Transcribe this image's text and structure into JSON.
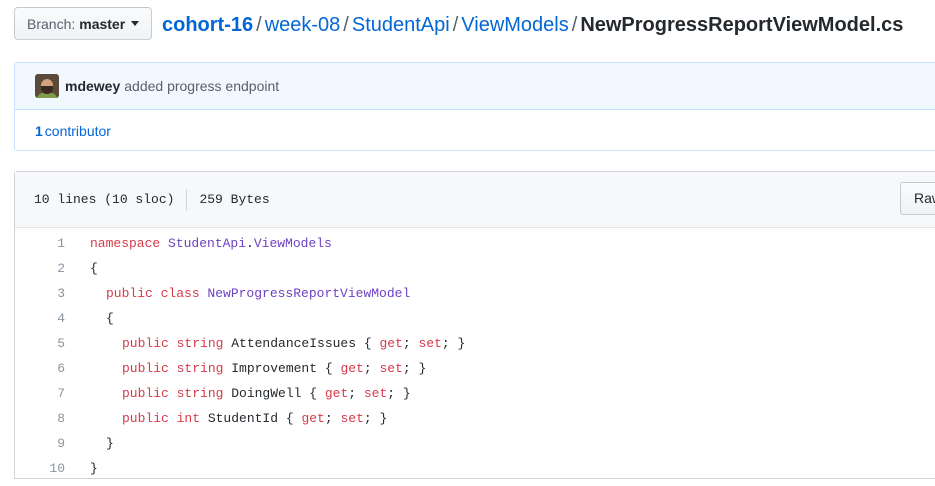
{
  "branch": {
    "prefix": "Branch:",
    "name": "master"
  },
  "breadcrumb": {
    "root": "cohort-16",
    "items": [
      "week-08",
      "StudentApi",
      "ViewModels"
    ],
    "separator": "/",
    "file": "NewProgressReportViewModel.cs"
  },
  "commit": {
    "author": "mdewey",
    "message": "added progress endpoint",
    "contributors_count": "1",
    "contributors_label": "contributor"
  },
  "file": {
    "lines_info": "10 lines (10 sloc)",
    "size": "259 Bytes",
    "raw_label": "Raw"
  },
  "code_lines": [
    {
      "n": "1",
      "indent": 0,
      "tokens": [
        [
          "kw",
          "namespace "
        ],
        [
          "ty",
          "StudentApi"
        ],
        [
          "tx",
          "."
        ],
        [
          "ty",
          "ViewModels"
        ]
      ]
    },
    {
      "n": "2",
      "indent": 0,
      "tokens": [
        [
          "tx",
          "{"
        ]
      ]
    },
    {
      "n": "3",
      "indent": 1,
      "tokens": [
        [
          "kw",
          "public class "
        ],
        [
          "ty",
          "NewProgressReportViewModel"
        ]
      ]
    },
    {
      "n": "4",
      "indent": 1,
      "tokens": [
        [
          "tx",
          "{"
        ]
      ]
    },
    {
      "n": "5",
      "indent": 2,
      "tokens": [
        [
          "kw",
          "public string "
        ],
        [
          "tx",
          "AttendanceIssues { "
        ],
        [
          "kw",
          "get"
        ],
        [
          "tx",
          "; "
        ],
        [
          "kw",
          "set"
        ],
        [
          "tx",
          "; }"
        ]
      ]
    },
    {
      "n": "6",
      "indent": 2,
      "tokens": [
        [
          "kw",
          "public string "
        ],
        [
          "tx",
          "Improvement { "
        ],
        [
          "kw",
          "get"
        ],
        [
          "tx",
          "; "
        ],
        [
          "kw",
          "set"
        ],
        [
          "tx",
          "; }"
        ]
      ]
    },
    {
      "n": "7",
      "indent": 2,
      "tokens": [
        [
          "kw",
          "public string "
        ],
        [
          "tx",
          "DoingWell { "
        ],
        [
          "kw",
          "get"
        ],
        [
          "tx",
          "; "
        ],
        [
          "kw",
          "set"
        ],
        [
          "tx",
          "; }"
        ]
      ]
    },
    {
      "n": "8",
      "indent": 2,
      "tokens": [
        [
          "kw",
          "public int "
        ],
        [
          "tx",
          "StudentId { "
        ],
        [
          "kw",
          "get"
        ],
        [
          "tx",
          "; "
        ],
        [
          "kw",
          "set"
        ],
        [
          "tx",
          "; }"
        ]
      ]
    },
    {
      "n": "9",
      "indent": 1,
      "tokens": [
        [
          "tx",
          "}"
        ]
      ]
    },
    {
      "n": "10",
      "indent": 0,
      "tokens": [
        [
          "tx",
          "}"
        ]
      ]
    }
  ]
}
